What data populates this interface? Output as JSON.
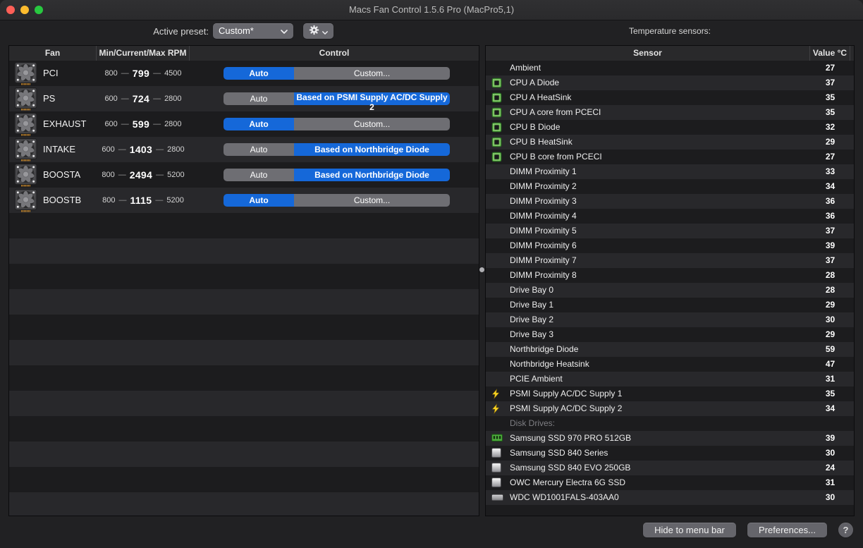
{
  "window": {
    "title": "Macs Fan Control 1.5.6 Pro (MacPro5,1)"
  },
  "colors": {
    "accent_blue": "#1568d9",
    "segment_gray": "#6e6e73",
    "cpu_green": "#6ab84f",
    "bolt_yellow": "#f8d323"
  },
  "toolbar": {
    "active_preset_label": "Active preset:",
    "preset_value": "Custom*",
    "temperature_sensors_label": "Temperature sensors:"
  },
  "fan_table": {
    "headers": [
      "Fan",
      "Min/Current/Max RPM",
      "Control"
    ],
    "auto_label": "Auto",
    "dash": "—",
    "rows": [
      {
        "name": "PCI",
        "min": "800",
        "current": "799",
        "max": "4500",
        "mode_label": "Custom...",
        "active": "auto"
      },
      {
        "name": "PS",
        "min": "600",
        "current": "724",
        "max": "2800",
        "mode_label": "Based on PSMI Supply AC/DC Supply 2",
        "active": "mode"
      },
      {
        "name": "EXHAUST",
        "min": "600",
        "current": "599",
        "max": "2800",
        "mode_label": "Custom...",
        "active": "auto"
      },
      {
        "name": "INTAKE",
        "min": "600",
        "current": "1403",
        "max": "2800",
        "mode_label": "Based on Northbridge Diode",
        "active": "mode"
      },
      {
        "name": "BOOSTA",
        "min": "800",
        "current": "2494",
        "max": "5200",
        "mode_label": "Based on Northbridge Diode",
        "active": "mode"
      },
      {
        "name": "BOOSTB",
        "min": "800",
        "current": "1115",
        "max": "5200",
        "mode_label": "Custom...",
        "active": "auto"
      }
    ]
  },
  "sensor_table": {
    "headers": [
      "Sensor",
      "Value °C"
    ],
    "rows": [
      {
        "icon": "none",
        "name": "Ambient",
        "value": "27"
      },
      {
        "icon": "cpu",
        "name": "CPU A Diode",
        "value": "37"
      },
      {
        "icon": "cpu",
        "name": "CPU A HeatSink",
        "value": "35"
      },
      {
        "icon": "cpu",
        "name": "CPU A core from PCECI",
        "value": "35"
      },
      {
        "icon": "cpu",
        "name": "CPU B Diode",
        "value": "32"
      },
      {
        "icon": "cpu",
        "name": "CPU B HeatSink",
        "value": "29"
      },
      {
        "icon": "cpu",
        "name": "CPU B core from PCECI",
        "value": "27"
      },
      {
        "icon": "none",
        "name": "DIMM Proximity 1",
        "value": "33"
      },
      {
        "icon": "none",
        "name": "DIMM Proximity 2",
        "value": "34"
      },
      {
        "icon": "none",
        "name": "DIMM Proximity 3",
        "value": "36"
      },
      {
        "icon": "none",
        "name": "DIMM Proximity 4",
        "value": "36"
      },
      {
        "icon": "none",
        "name": "DIMM Proximity 5",
        "value": "37"
      },
      {
        "icon": "none",
        "name": "DIMM Proximity 6",
        "value": "39"
      },
      {
        "icon": "none",
        "name": "DIMM Proximity 7",
        "value": "37"
      },
      {
        "icon": "none",
        "name": "DIMM Proximity 8",
        "value": "28"
      },
      {
        "icon": "none",
        "name": "Drive Bay 0",
        "value": "28"
      },
      {
        "icon": "none",
        "name": "Drive Bay 1",
        "value": "29"
      },
      {
        "icon": "none",
        "name": "Drive Bay 2",
        "value": "30"
      },
      {
        "icon": "none",
        "name": "Drive Bay 3",
        "value": "29"
      },
      {
        "icon": "none",
        "name": "Northbridge Diode",
        "value": "59"
      },
      {
        "icon": "none",
        "name": "Northbridge Heatsink",
        "value": "47"
      },
      {
        "icon": "none",
        "name": "PCIE Ambient",
        "value": "31"
      },
      {
        "icon": "bolt",
        "name": "PSMI Supply AC/DC Supply 1",
        "value": "35"
      },
      {
        "icon": "bolt",
        "name": "PSMI Supply AC/DC Supply 2",
        "value": "34"
      },
      {
        "icon": "none",
        "name": "Disk Drives:",
        "value": "",
        "group": true
      },
      {
        "icon": "nvme",
        "name": "Samsung SSD 970 PRO 512GB",
        "value": "39"
      },
      {
        "icon": "ssd",
        "name": "Samsung SSD 840 Series",
        "value": "30"
      },
      {
        "icon": "ssd",
        "name": "Samsung SSD 840 EVO 250GB",
        "value": "24"
      },
      {
        "icon": "ssd",
        "name": "OWC Mercury Electra 6G SSD",
        "value": "31"
      },
      {
        "icon": "hdd",
        "name": "WDC WD1001FALS-403AA0",
        "value": "30"
      }
    ]
  },
  "footer": {
    "hide_button": "Hide to menu bar",
    "preferences_button": "Preferences...",
    "help_label": "?"
  }
}
